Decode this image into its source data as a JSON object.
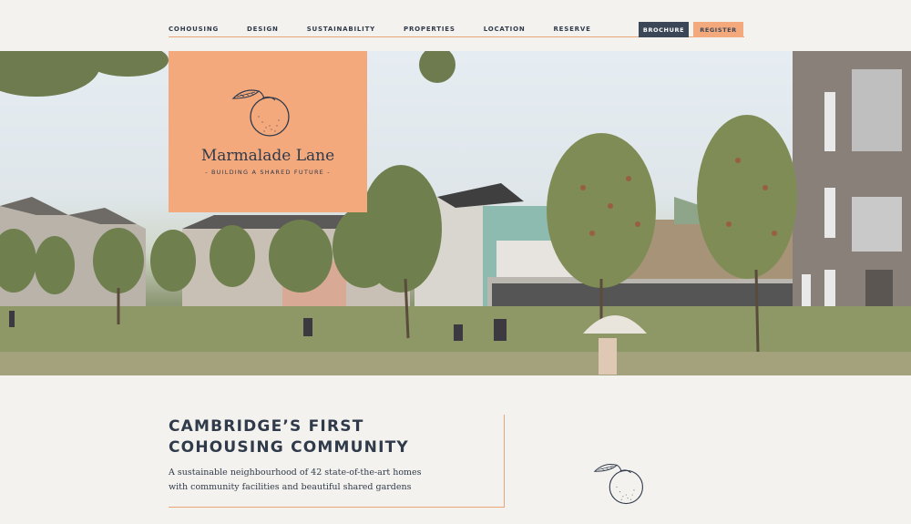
{
  "nav": {
    "items": [
      "COHOUSING",
      "DESIGN",
      "SUSTAINABILITY",
      "PROPERTIES",
      "LOCATION",
      "RESERVE"
    ],
    "brochure_label": "BROCHURE",
    "register_label": "REGISTER"
  },
  "logo": {
    "title": "Marmalade Lane",
    "tagline": "- BUILDING A SHARED FUTURE -"
  },
  "intro": {
    "title_line1": "CAMBRIDGE’S FIRST",
    "title_line2": "COHOUSING COMMUNITY",
    "text_line1": "A sustainable neighbourhood of 42 state-of-the-art homes",
    "text_line2": "with community facilities and beautiful shared gardens"
  },
  "colors": {
    "accent": "#f4a97d",
    "navy": "#3b4657",
    "background": "#f4f2ee",
    "rule": "#e8a678"
  },
  "icons": [
    "orange-logo-icon",
    "orange-icon"
  ]
}
